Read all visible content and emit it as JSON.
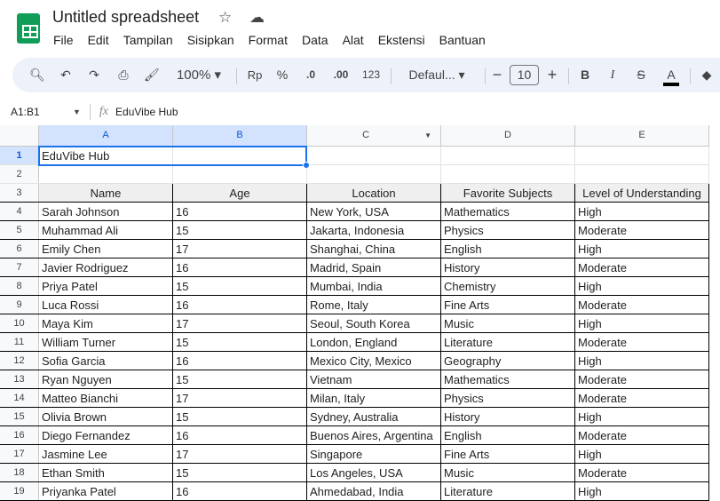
{
  "app": {
    "title": "Untitled spreadsheet"
  },
  "menu": [
    "File",
    "Edit",
    "Tampilan",
    "Sisipkan",
    "Format",
    "Data",
    "Alat",
    "Ekstensi",
    "Bantuan"
  ],
  "toolbar": {
    "zoom": "100%",
    "currency": "Rp",
    "percent": "%",
    "dec_decrease": ".0",
    "dec_increase": ".00",
    "number_format": "123",
    "font": "Defaul...",
    "font_size": "10",
    "bold": "B",
    "italic": "I",
    "text_color": "A"
  },
  "formula_bar": {
    "name_box": "A1:B1",
    "fx": "fx",
    "value": "EduVibe Hub"
  },
  "columns": [
    "A",
    "B",
    "C",
    "D",
    "E"
  ],
  "rows": [
    [
      "EduVibe Hub",
      "",
      "",
      "",
      ""
    ],
    [
      "",
      "",
      "",
      "",
      ""
    ],
    [
      "Name",
      "Age",
      "Location",
      "Favorite Subjects",
      "Level of Understanding"
    ],
    [
      "Sarah Johnson",
      "16",
      "New York, USA",
      "Mathematics",
      "High"
    ],
    [
      "Muhammad Ali",
      "15",
      "Jakarta, Indonesia",
      "Physics",
      "Moderate"
    ],
    [
      "Emily Chen",
      "17",
      "Shanghai, China",
      "English",
      "High"
    ],
    [
      "Javier Rodriguez",
      "16",
      "Madrid, Spain",
      "History",
      "Moderate"
    ],
    [
      "Priya Patel",
      "15",
      "Mumbai, India",
      "Chemistry",
      "High"
    ],
    [
      "Luca Rossi",
      "16",
      "Rome, Italy",
      "Fine Arts",
      "Moderate"
    ],
    [
      "Maya Kim",
      "17",
      "Seoul, South Korea",
      "Music",
      "High"
    ],
    [
      "William Turner",
      "15",
      "London, England",
      "Literature",
      "Moderate"
    ],
    [
      "Sofia Garcia",
      "16",
      "Mexico City, Mexico",
      "Geography",
      "High"
    ],
    [
      "Ryan Nguyen",
      "15",
      "Vietnam",
      "Mathematics",
      "Moderate"
    ],
    [
      "Matteo Bianchi",
      "17",
      "Milan, Italy",
      "Physics",
      "Moderate"
    ],
    [
      "Olivia Brown",
      "15",
      "Sydney, Australia",
      "History",
      "High"
    ],
    [
      "Diego Fernandez",
      "16",
      "Buenos Aires, Argentina",
      "English",
      "Moderate"
    ],
    [
      "Jasmine Lee",
      "17",
      "Singapore",
      "Fine Arts",
      "High"
    ],
    [
      "Ethan Smith",
      "15",
      "Los Angeles, USA",
      "Music",
      "Moderate"
    ],
    [
      "Priyanka Patel",
      "16",
      "Ahmedabad, India",
      "Literature",
      "High"
    ]
  ]
}
